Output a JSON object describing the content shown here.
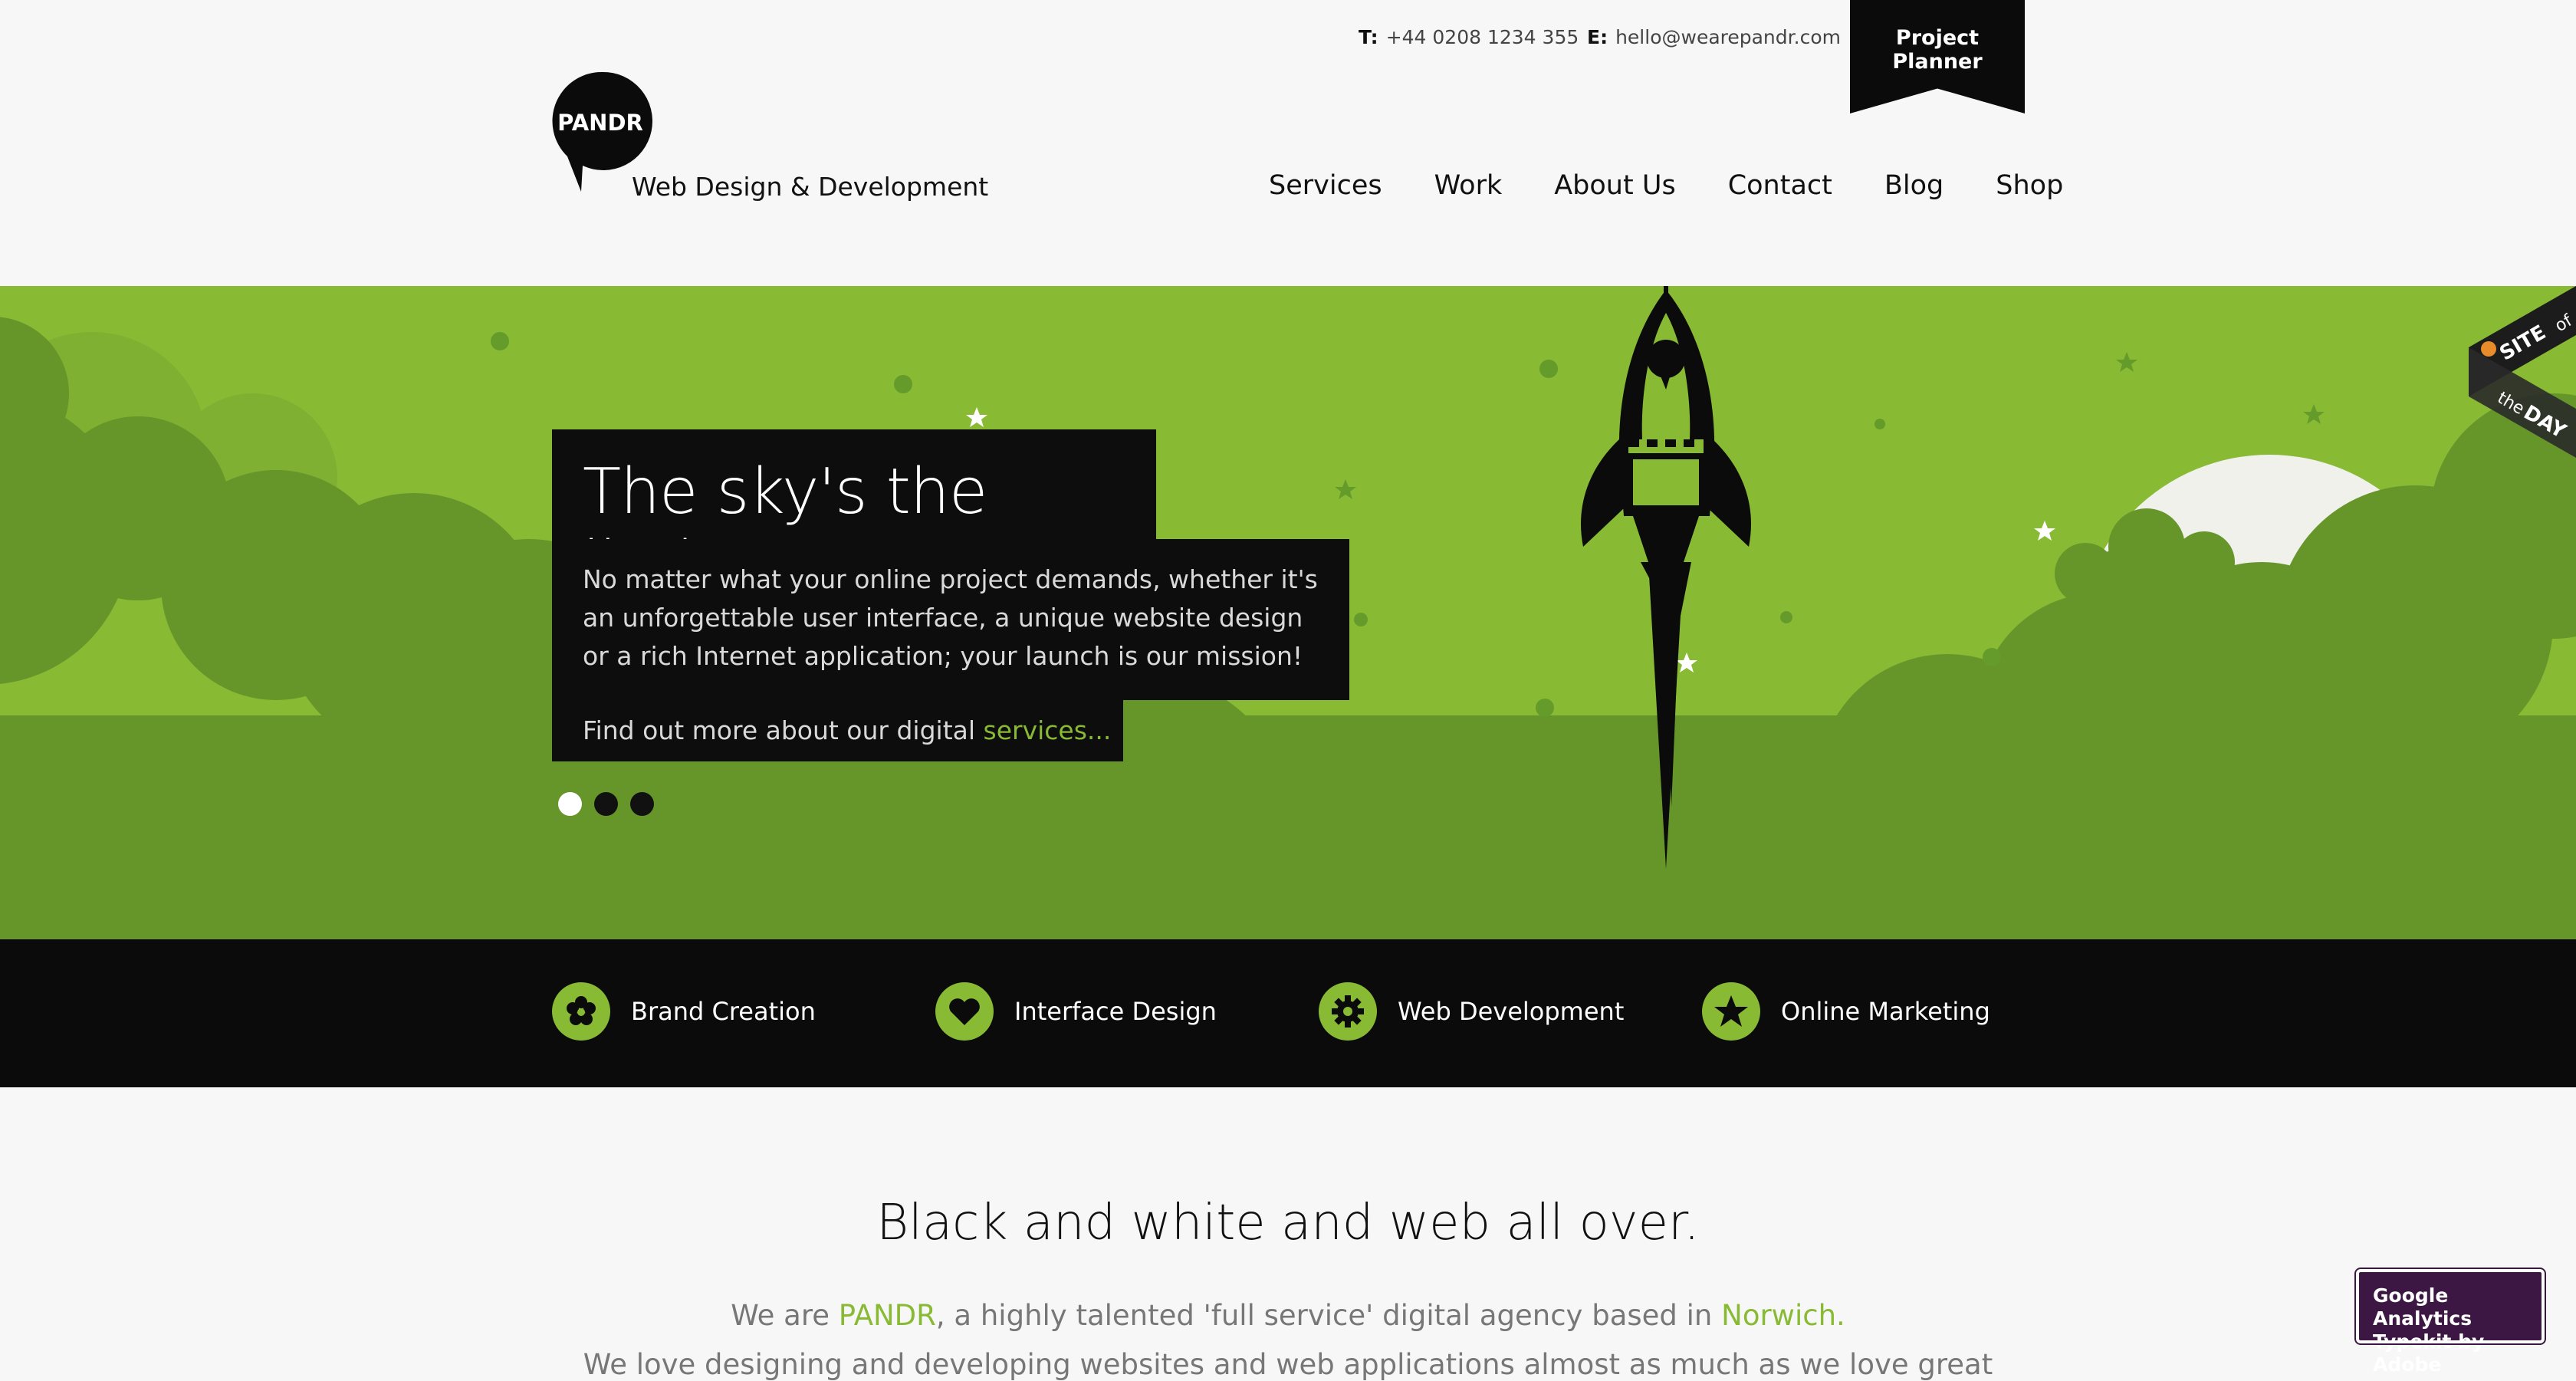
{
  "header": {
    "phone_label": "T:",
    "phone": "+44 0208 1234 355",
    "email_label": "E:",
    "email": "hello@wearepandr.com",
    "project_planner": "Project Planner",
    "logo_text": "PANDR",
    "tagline": "Web Design & Development"
  },
  "nav": [
    "Services",
    "Work",
    "About Us",
    "Contact",
    "Blog",
    "Shop"
  ],
  "hero": {
    "headline": "The sky's the limit!",
    "intro": "No matter what your online project demands, whether it's an unforgettable user interface, a unique website design or a rich Internet application; your launch is our mission!",
    "more_prefix": "Find out more about our digital ",
    "more_link": "services...",
    "badge": {
      "line1": "SITE",
      "line2": "of",
      "line3": "the",
      "line4": "DAY"
    }
  },
  "services": [
    {
      "label": "Brand Creation",
      "icon": "flower-icon"
    },
    {
      "label": "Interface Design",
      "icon": "heart-icon"
    },
    {
      "label": "Web Development",
      "icon": "gear-icon"
    },
    {
      "label": "Online Marketing",
      "icon": "star-icon"
    }
  ],
  "about": {
    "title": "Black and white and web all over.",
    "line1_prefix": "We are ",
    "line1_brand": "PANDR",
    "line1_mid": ", a highly talented 'full service' digital agency based in ",
    "line1_city": "Norwich.",
    "line2": "We love designing and developing websites and web applications almost as much as we love great"
  },
  "overlay_badge": {
    "line1": "Google Analytics",
    "line2": "Typekit by Adobe"
  },
  "colors": {
    "brand_green": "#88ba34",
    "dark_green": "#66962a",
    "black": "#0b0b0b"
  }
}
